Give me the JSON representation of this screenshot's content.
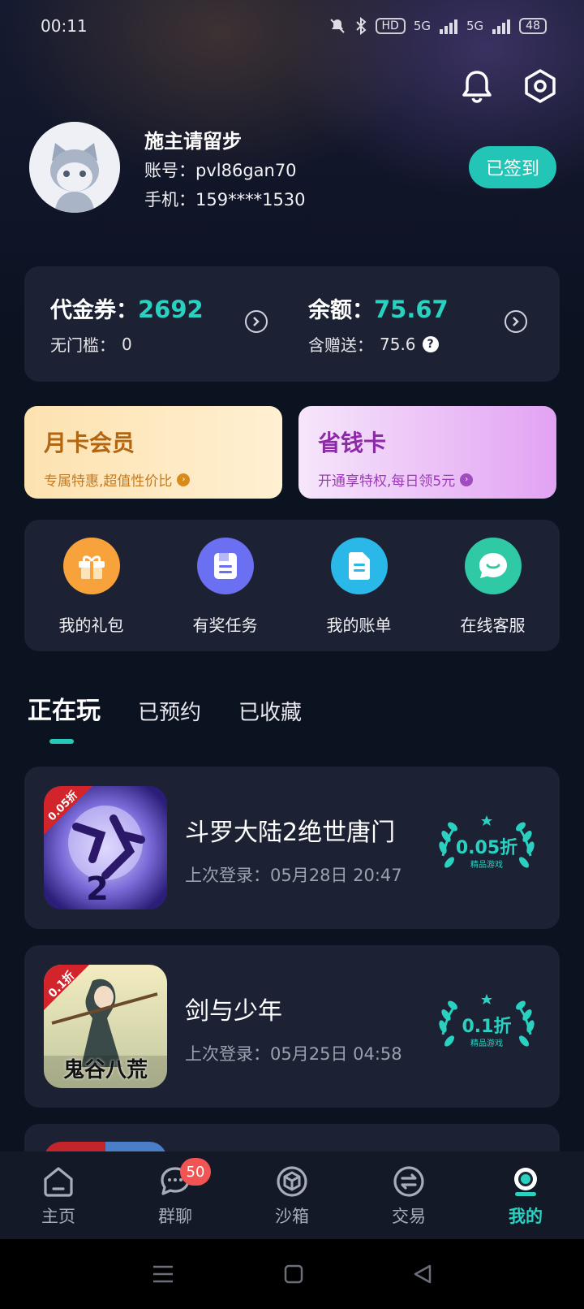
{
  "status_bar": {
    "time": "00:11",
    "network_hd": "HD",
    "signal1": "5G",
    "signal2": "5G",
    "battery": "48"
  },
  "profile": {
    "nickname": "施主请留步",
    "account_label": "账号：",
    "account": "pvl86gan70",
    "phone_label": "手机：",
    "phone": "159****1530",
    "checkin_label": "已签到"
  },
  "wallet": {
    "voucher_label": "代金券：",
    "voucher_value": "2692",
    "no_threshold_label": "无门槛：",
    "no_threshold_value": "0",
    "balance_label": "余额：",
    "balance_value": "75.67",
    "gift_label": "含赠送：",
    "gift_value": "75.6"
  },
  "promos": {
    "monthly": {
      "title": "月卡会员",
      "subtitle": "专属特惠,超值性价比"
    },
    "saver": {
      "title": "省钱卡",
      "subtitle": "开通享特权,每日领5元"
    }
  },
  "quick_actions": [
    {
      "label": "我的礼包",
      "icon": "gift-icon",
      "color": "#f7a23b"
    },
    {
      "label": "有奖任务",
      "icon": "task-icon",
      "color": "#6b6ff2"
    },
    {
      "label": "我的账单",
      "icon": "bill-icon",
      "color": "#2ab8e8"
    },
    {
      "label": "在线客服",
      "icon": "chat-icon",
      "color": "#2fc9a6"
    }
  ],
  "tabs": [
    "正在玩",
    "已预约",
    "已收藏"
  ],
  "games": [
    {
      "name": "斗罗大陆2绝世唐门",
      "last_login_label": "上次登录：",
      "last_login": "05月28日 20:47",
      "discount": "0.05折",
      "discount_sub": "精品游戏",
      "corner": "0.05折"
    },
    {
      "name": "剑与少年",
      "last_login_label": "上次登录：",
      "last_login": "05月25日 04:58",
      "discount": "0.1折",
      "discount_sub": "精品游戏",
      "corner": "0.1折",
      "art_text": "鬼谷八荒"
    }
  ],
  "bottom_nav": [
    {
      "label": "主页",
      "icon": "home-icon"
    },
    {
      "label": "群聊",
      "icon": "group-chat-icon",
      "badge": "50"
    },
    {
      "label": "沙箱",
      "icon": "sandbox-icon"
    },
    {
      "label": "交易",
      "icon": "trade-icon"
    },
    {
      "label": "我的",
      "icon": "profile-icon",
      "active": true
    }
  ],
  "colors": {
    "accent": "#2ad1c0",
    "card": "#1c2233",
    "background": "#0b1220"
  }
}
